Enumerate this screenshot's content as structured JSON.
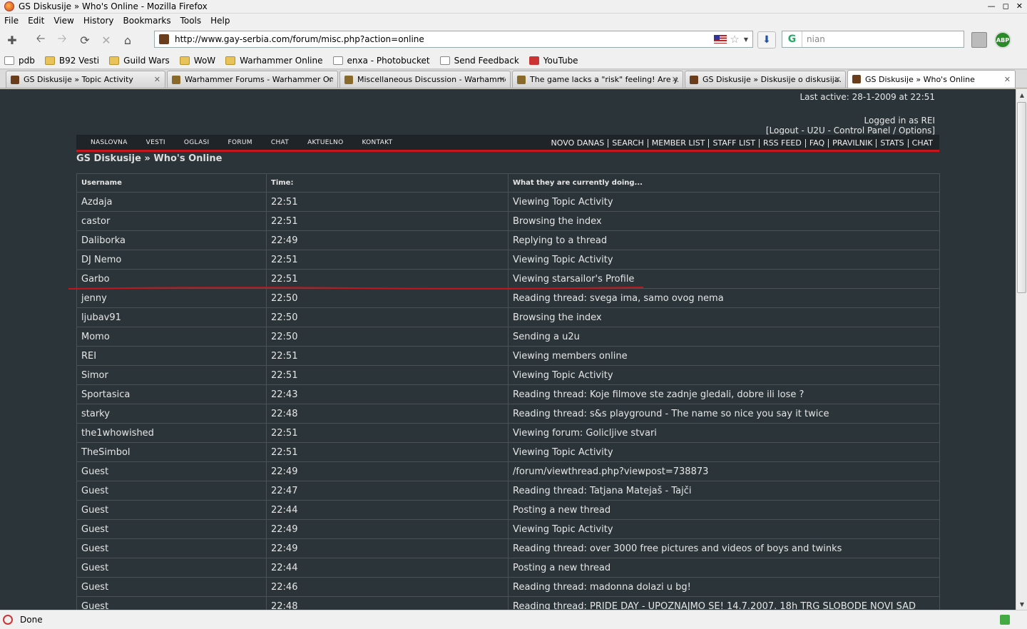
{
  "window": {
    "title": "GS Diskusije » Who's Online - Mozilla Firefox"
  },
  "menu": [
    "File",
    "Edit",
    "View",
    "History",
    "Bookmarks",
    "Tools",
    "Help"
  ],
  "address_bar": {
    "url": "http://www.gay-serbia.com/forum/misc.php?action=online"
  },
  "search_bar": {
    "value": "nian"
  },
  "bookmarks": [
    {
      "label": "pdb",
      "icon": "page"
    },
    {
      "label": "B92 Vesti",
      "icon": "folder"
    },
    {
      "label": "Guild Wars",
      "icon": "folder"
    },
    {
      "label": "WoW",
      "icon": "folder"
    },
    {
      "label": "Warhammer Online",
      "icon": "folder"
    },
    {
      "label": "enxa - Photobucket",
      "icon": "page"
    },
    {
      "label": "Send Feedback",
      "icon": "page"
    },
    {
      "label": "YouTube",
      "icon": "youtube"
    }
  ],
  "tabs": [
    {
      "label": "GS Diskusije » Topic Activity"
    },
    {
      "label": "Warhammer Forums - Warhammer On..."
    },
    {
      "label": "Miscellaneous Discussion - Warhamme..."
    },
    {
      "label": "The game lacks a \"risk\" feeling! Are y..."
    },
    {
      "label": "GS Diskusije » Diskusije o diskusija..."
    },
    {
      "label": "GS Diskusije » Who's Online"
    }
  ],
  "page": {
    "last_active": "Last active: 28-1-2009 at 22:51",
    "logged_in": "Logged in as REI",
    "user_links": "[Logout - U2U - Control Panel / Options]",
    "site_nav_left": [
      "NASLOVNA",
      "VESTI",
      "OGLASI",
      "FORUM",
      "CHAT",
      "AKTUELNO",
      "KONTAKT"
    ],
    "site_nav_right": [
      "NOVO DANAS",
      "SEARCH",
      "MEMBER LIST",
      "STAFF LIST",
      "RSS FEED",
      "FAQ",
      "PRAVILNIK",
      "STATS",
      "CHAT"
    ],
    "breadcrumb": "GS Diskusije  » Who's Online",
    "table": {
      "headers": [
        "Username",
        "Time:",
        "What they are currently doing..."
      ],
      "rows": [
        [
          "Azdaja",
          "22:51",
          "Viewing Topic Activity"
        ],
        [
          "castor",
          "22:51",
          "Browsing the index"
        ],
        [
          "Daliborka",
          "22:49",
          "Replying to a thread"
        ],
        [
          "DJ Nemo",
          "22:51",
          "Viewing Topic Activity"
        ],
        [
          "Garbo",
          "22:51",
          "Viewing starsailor's Profile"
        ],
        [
          "jenny",
          "22:50",
          "Reading thread: svega ima, samo ovog nema"
        ],
        [
          "ljubav91",
          "22:50",
          "Browsing the index"
        ],
        [
          "Momo",
          "22:50",
          "Sending a u2u"
        ],
        [
          "REI",
          "22:51",
          "Viewing members online"
        ],
        [
          "Simor",
          "22:51",
          "Viewing Topic Activity"
        ],
        [
          "Sportasica",
          "22:43",
          "Reading thread: Koje filmove ste zadnje gledali, dobre ili lose ?"
        ],
        [
          "starky",
          "22:48",
          "Reading thread: s&s playground - The name so nice you say it twice"
        ],
        [
          "the1whowished",
          "22:51",
          "Viewing forum: Golicljive stvari"
        ],
        [
          "TheSimbol",
          "22:51",
          "Viewing Topic Activity"
        ],
        [
          "Guest",
          "22:49",
          "/forum/viewthread.php?viewpost=738873"
        ],
        [
          "Guest",
          "22:47",
          "Reading thread: Tatjana Matejaš - Tajči"
        ],
        [
          "Guest",
          "22:44",
          "Posting a new thread"
        ],
        [
          "Guest",
          "22:49",
          "Viewing Topic Activity"
        ],
        [
          "Guest",
          "22:49",
          "Reading thread: over 3000 free pictures and videos of boys and twinks"
        ],
        [
          "Guest",
          "22:44",
          "Posting a new thread"
        ],
        [
          "Guest",
          "22:46",
          "Reading thread: madonna dolazi u bg!"
        ],
        [
          "Guest",
          "22:48",
          "Reading thread: PRIDE DAY - UPOZNAJMO SE! 14.7.2007. 18h TRG SLOBODE NOVI SAD"
        ]
      ]
    }
  },
  "status": {
    "text": "Done"
  },
  "colors": {
    "page_bg": "#2b3438",
    "nav_bg": "#1e2427",
    "accent_red": "#c4161c",
    "text": "#e6e6e6"
  }
}
